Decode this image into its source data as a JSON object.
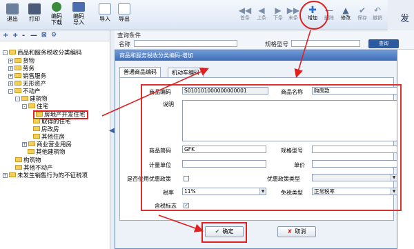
{
  "toolbar": {
    "buttons": [
      {
        "label": "退出",
        "color": "#6a7f9c"
      },
      {
        "label": "打印",
        "color": "#4a5c78"
      },
      {
        "label": "编码",
        "label2": "下载",
        "color": "#3a8b3a"
      },
      {
        "label": "编码",
        "label2": "导入",
        "color": "#4b6db0"
      },
      {
        "label": "导入",
        "color": "#7d96b8"
      },
      {
        "label": "导出",
        "color": "#7d96b8"
      }
    ],
    "nav": [
      {
        "glyph": "◀◀",
        "label": "首条"
      },
      {
        "glyph": "◀",
        "label": "上条"
      },
      {
        "glyph": "▶",
        "label": "下条"
      },
      {
        "glyph": "▶▶",
        "label": "末条"
      }
    ],
    "actions": [
      {
        "glyph": "✚",
        "label": "增加",
        "color": "#2a6fd0"
      },
      {
        "glyph": "—",
        "label": "删除",
        "color": "#2a6fd0"
      },
      {
        "glyph": "▲",
        "label": "修改",
        "color": "#4a6a90"
      },
      {
        "glyph": "✔",
        "label": "保存",
        "color": "#8a9ab0"
      },
      {
        "glyph": "↶",
        "label": "撤销",
        "color": "#8a9ab0"
      }
    ],
    "edge_text": "发"
  },
  "tree_tools": [
    "+",
    "+",
    "-",
    "—",
    "⊠",
    "⚙"
  ],
  "tree": [
    {
      "label": "商品和服务税收分类编码",
      "pm": "-"
    },
    {
      "label": "货物",
      "pm": "+"
    },
    {
      "label": "劳务",
      "pm": "+"
    },
    {
      "label": "销售服务",
      "pm": "+"
    },
    {
      "label": "无形资产",
      "pm": "+"
    },
    {
      "label": "不动产",
      "pm": "-"
    },
    {
      "label": "建筑物",
      "pm": "-"
    },
    {
      "label": "住宅",
      "pm": "-"
    },
    {
      "label": "房地产开发住宅",
      "pm": ""
    },
    {
      "label": "取得的住宅",
      "pm": ""
    },
    {
      "label": "房改房",
      "pm": ""
    },
    {
      "label": "其他住房",
      "pm": ""
    },
    {
      "label": "商业营业用房",
      "pm": "+"
    },
    {
      "label": "其他建筑物",
      "pm": ""
    },
    {
      "label": "构筑物",
      "pm": ""
    },
    {
      "label": "其他不动产",
      "pm": ""
    },
    {
      "label": "未发生销售行为的不征税项",
      "pm": "+"
    }
  ],
  "background": {
    "query_label": "查询条件",
    "name_label": "名称",
    "spec_label": "规格型号",
    "search_label": "查询"
  },
  "dialog": {
    "title": "商品和服务税收分类编码-增加",
    "tabs": [
      "普通商品编码",
      "机动车编码"
    ],
    "fields": {
      "code_label": "商品编码",
      "code_value": "S010101000000000001",
      "name_label": "商品名称",
      "name_value": "购房款",
      "desc_label": "说明",
      "short_label": "商品简码",
      "short_value": "GFK",
      "spec_label": "规格型号",
      "unit_label": "计量单位",
      "price_label": "单价",
      "pref_label": "是否使用优惠政策",
      "pref_type_label": "优惠政策类型",
      "rate_label": "税率",
      "rate_value": "11%",
      "exempt_label": "免税类型",
      "exempt_value": "正常税率",
      "tax_incl_label": "含税标志"
    },
    "ok_label": "确定",
    "cancel_label": "取消"
  },
  "colors": {
    "highlight": "#e02020",
    "accent": "#2a6fd0"
  }
}
